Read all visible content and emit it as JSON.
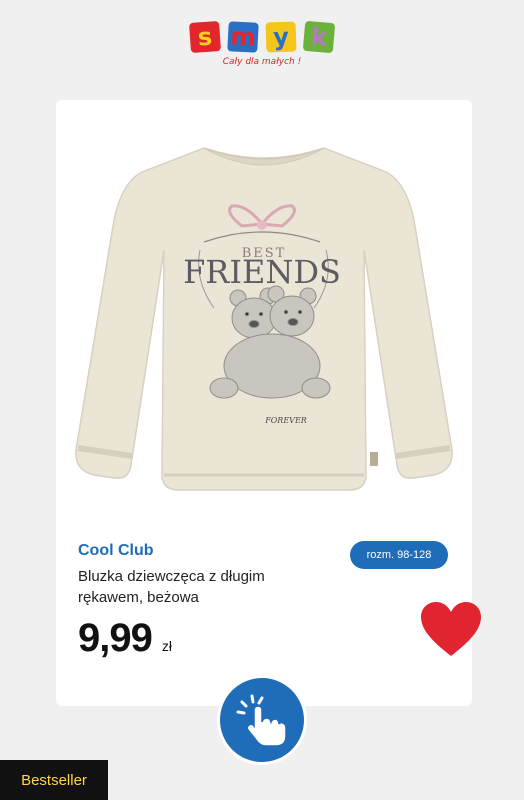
{
  "logo": {
    "letters": [
      "s",
      "m",
      "y",
      "k"
    ],
    "letter_colors": [
      {
        "bg": "#e3262c",
        "fg": "#f7d11b"
      },
      {
        "bg": "#2b6fc4",
        "fg": "#e3262c"
      },
      {
        "bg": "#f4c51a",
        "fg": "#2b6fc4"
      },
      {
        "bg": "#6ab23a",
        "fg": "#b57ac2"
      }
    ],
    "tagline": "Cały dla małych !"
  },
  "product": {
    "brand": "Cool Club",
    "size_badge": "rozm. 98-128",
    "name": "Bluzka dziewczęca z długim rękawem, beżowa",
    "price_value": "9,99",
    "price_currency": "zł",
    "print_top": "BEST",
    "print_main": "FRIENDS",
    "print_bottom": "FOREVER"
  },
  "badge": {
    "bestseller_label": "Bestseller"
  },
  "colors": {
    "accent_blue": "#1f6db8",
    "heart_red": "#e02530",
    "shirt": "#ebe5d6",
    "badge_text": "#ffd34d"
  },
  "icons": {
    "favorite": "heart-icon",
    "tap": "hand-pointer-icon"
  }
}
